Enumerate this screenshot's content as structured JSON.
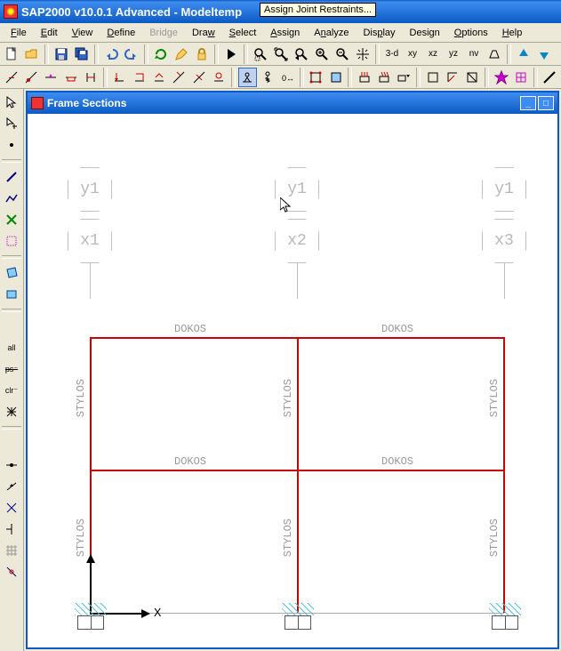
{
  "app": {
    "title": "SAP2000 v10.0.1 Advanced  -  Modeltemp"
  },
  "menu": {
    "file": "File",
    "edit": "Edit",
    "view": "View",
    "define": "Define",
    "bridge": "Bridge",
    "draw": "Draw",
    "select": "Select",
    "assign": "Assign",
    "analyze": "Analyze",
    "display": "Display",
    "design": "Design",
    "options": "Options",
    "help": "Help"
  },
  "toolbar2_views": {
    "three_d": "3-d",
    "xy": "xy",
    "xz": "xz",
    "yz": "yz",
    "nv": "nv"
  },
  "tooltip": "Assign Joint Restraints...",
  "doc": {
    "title": "Frame Sections"
  },
  "grid": {
    "col_labels": [
      "y1",
      "x1",
      "y1",
      "x2",
      "y1",
      "x3"
    ],
    "beam_label": "DOKOS",
    "column_label": "STYLOS",
    "axis_x": "X"
  }
}
